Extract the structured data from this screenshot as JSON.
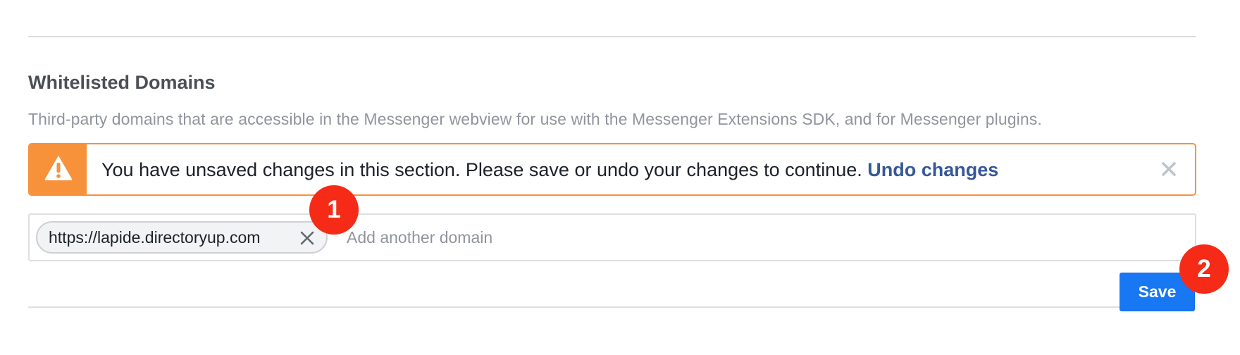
{
  "section": {
    "title": "Whitelisted Domains",
    "description": "Third-party domains that are accessible in the Messenger webview for use with the Messenger Extensions SDK, and for Messenger plugins."
  },
  "alert": {
    "icon": "warning-icon",
    "message": "You have unsaved changes in this section. Please save or undo your changes to continue.",
    "link_label": "Undo changes",
    "close_icon": "close-icon",
    "accent_color": "#f7923b"
  },
  "domains": {
    "chips": [
      {
        "value": "https://lapide.directoryup.com",
        "remove_icon": "remove-icon"
      }
    ],
    "input_value": "",
    "placeholder": "Add another domain"
  },
  "save": {
    "label": "Save",
    "color": "#1877f2"
  },
  "markers": [
    {
      "label": "1",
      "color": "#f52b17"
    },
    {
      "label": "2",
      "color": "#f52b17"
    }
  ]
}
